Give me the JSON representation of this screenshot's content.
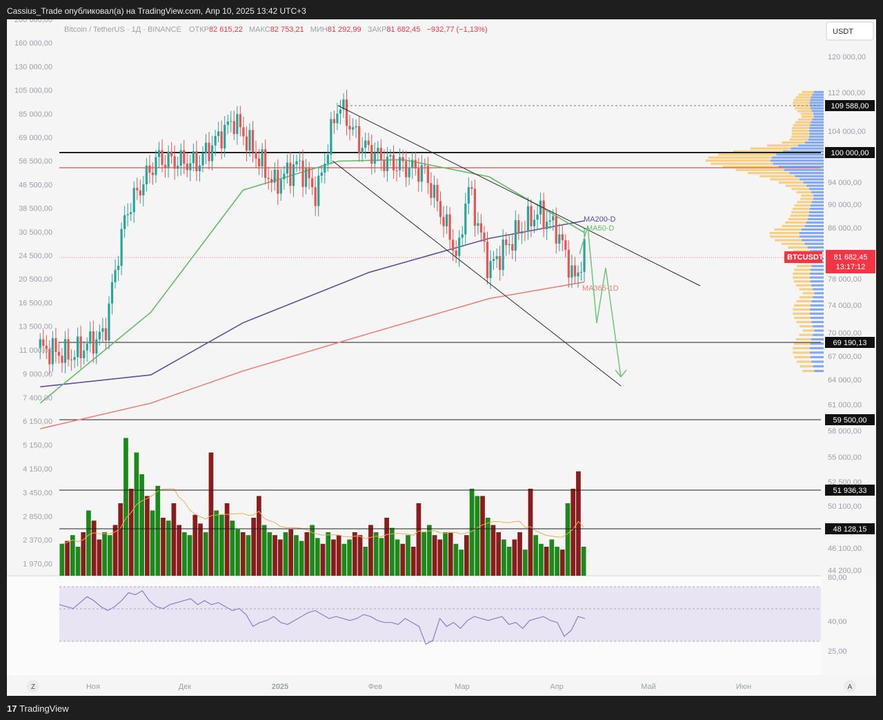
{
  "header": {
    "publish_line": "Cassius_Trade опубликовал(а) на TradingView.com, Апр 10, 2025 13:42 UTC+3"
  },
  "footer": {
    "brand": "TradingView",
    "logo_icon": "tradingview-logo-icon"
  },
  "symbol_info": {
    "name": "Bitcoin / TetherUS · 1Д · BINANCE",
    "open_label": "ОТКР",
    "open": "82 615,22",
    "high_label": "МАКС",
    "high": "82 753,21",
    "low_label": "МИН",
    "low": "81 292,99",
    "close_label": "ЗАКР",
    "close": "81 682,45",
    "change": "−932,77 (−1,13%)",
    "down_color": "#f23645"
  },
  "currency_button": "USDT",
  "corner_buttons": {
    "left": "Z",
    "right": "A"
  },
  "chart_data": {
    "type": "candlestick",
    "symbol": "BTCUSDT",
    "last_price": "81 682,45",
    "countdown": "13:17:12",
    "left_axis": [
      "200 000,00",
      "160 000,00",
      "130 000,00",
      "105 000,00",
      "85 000,00",
      "69 000,00",
      "56 500,00",
      "46 500,00",
      "38 500,00",
      "30 500,00",
      "24 500,00",
      "20 500,00",
      "16 500,00",
      "13 500,00",
      "11 000,00",
      "9 000,00",
      "7 400,00",
      "6 150,00",
      "5 150,00",
      "4 150,00",
      "3 450,00",
      "2 850,00",
      "2 370,00",
      "1 970,00"
    ],
    "right_axis": [
      "120 000,00",
      "112 000,00",
      "104 000,00",
      "94 000,00",
      "90 000,00",
      "86 000,00",
      "78 000,00",
      "74 000,00",
      "70 000,00",
      "67 000,00",
      "64 000,00",
      "61 000,00",
      "58 000,00",
      "55 000,00",
      "52 500,00",
      "50 100,00",
      "46 100,00",
      "44 200,00"
    ],
    "x_axis": [
      "Ноя",
      "Дек",
      "2025",
      "Фев",
      "Мар",
      "Апр",
      "Май",
      "Июн"
    ],
    "levels": [
      {
        "value": 109588.0,
        "label": "109 588,00",
        "style": "dashed"
      },
      {
        "value": 100000.0,
        "label": "100 000,00",
        "style": "solid-thick"
      },
      {
        "value": 96500,
        "label": "",
        "style": "red"
      },
      {
        "value": 69190.13,
        "label": "69 190,13",
        "style": "solid"
      },
      {
        "value": 59500.0,
        "label": "59 500,00",
        "style": "solid"
      },
      {
        "value": 51936.33,
        "label": "51 936,33",
        "style": "solid"
      },
      {
        "value": 48128.15,
        "label": "48 128,15",
        "style": "solid"
      }
    ],
    "ma_labels": {
      "ma200": "MA200-D",
      "ma200_color": "#5b4fa0",
      "ma50": "MA50-D",
      "ma50_color": "#66bb6a",
      "ma365": "MA365-1D",
      "ma365_color": "#ef8079"
    },
    "price_series": [
      [
        "2024-10-15",
        67000
      ],
      [
        "2024-10-25",
        66000
      ],
      [
        "2024-11-05",
        69000
      ],
      [
        "2024-11-12",
        88000
      ],
      [
        "2024-11-22",
        98000
      ],
      [
        "2024-12-05",
        97000
      ],
      [
        "2024-12-17",
        106000
      ],
      [
        "2024-12-30",
        93000
      ],
      [
        "2025-01-07",
        97000
      ],
      [
        "2025-01-13",
        91000
      ],
      [
        "2025-01-20",
        109500
      ],
      [
        "2025-01-27",
        101000
      ],
      [
        "2025-02-04",
        97500
      ],
      [
        "2025-02-17",
        95500
      ],
      [
        "2025-02-28",
        80000
      ],
      [
        "2025-03-03",
        93000
      ],
      [
        "2025-03-10",
        78500
      ],
      [
        "2025-03-20",
        85000
      ],
      [
        "2025-03-26",
        88000
      ],
      [
        "2025-04-01",
        85000
      ],
      [
        "2025-04-07",
        76500
      ],
      [
        "2025-04-10",
        81682
      ]
    ],
    "ma_series": {
      "ma200": [
        [
          "2024-10-15",
          62000
        ],
        [
          "2024-11-20",
          63500
        ],
        [
          "2024-12-20",
          70500
        ],
        [
          "2025-01-30",
          78000
        ],
        [
          "2025-03-10",
          83500
        ],
        [
          "2025-04-10",
          86500
        ]
      ],
      "ma50": [
        [
          "2024-10-15",
          60000
        ],
        [
          "2024-11-20",
          72000
        ],
        [
          "2024-12-20",
          92000
        ],
        [
          "2025-01-20",
          97500
        ],
        [
          "2025-02-10",
          97800
        ],
        [
          "2025-03-10",
          94500
        ],
        [
          "2025-04-10",
          84500
        ]
      ],
      "ma365": [
        [
          "2024-10-15",
          57000
        ],
        [
          "2024-11-20",
          60000
        ],
        [
          "2024-12-20",
          64000
        ],
        [
          "2025-01-30",
          69000
        ],
        [
          "2025-03-10",
          74000
        ],
        [
          "2025-04-10",
          76500
        ]
      ]
    },
    "volume": {
      "unit": "relative",
      "values": [
        0.22,
        0.24,
        0.28,
        0.2,
        0.3,
        0.45,
        0.38,
        0.25,
        0.3,
        0.28,
        0.35,
        0.5,
        0.95,
        0.6,
        0.85,
        0.7,
        0.55,
        0.45,
        0.62,
        0.4,
        0.38,
        0.5,
        0.35,
        0.3,
        0.28,
        0.42,
        0.36,
        0.3,
        0.85,
        0.45,
        0.42,
        0.5,
        0.38,
        0.32,
        0.3,
        0.28,
        0.4,
        0.55,
        0.35,
        0.3,
        0.28,
        0.25,
        0.3,
        0.32,
        0.28,
        0.24,
        0.3,
        0.35,
        0.26,
        0.22,
        0.3,
        0.25,
        0.28,
        0.22,
        0.25,
        0.3,
        0.28,
        0.2,
        0.35,
        0.3,
        0.26,
        0.4,
        0.33,
        0.25,
        0.22,
        0.28,
        0.2,
        0.5,
        0.3,
        0.35,
        0.28,
        0.25,
        0.3,
        0.3,
        0.22,
        0.18,
        0.28,
        0.6,
        0.55,
        0.55,
        0.4,
        0.35,
        0.3,
        0.25,
        0.2,
        0.25,
        0.3,
        0.18,
        0.6,
        0.28,
        0.22,
        0.2,
        0.25,
        0.2,
        0.18,
        0.5,
        0.6,
        0.72,
        0.2
      ],
      "ma_color": "#f5a94d",
      "up_color": "#1b8a1b",
      "down_color": "#8a1c1c"
    },
    "rsi": {
      "axis": [
        "80,00",
        "40,00",
        "25,00"
      ],
      "values": [
        62,
        60,
        58,
        64,
        70,
        66,
        60,
        56,
        60,
        66,
        74,
        72,
        76,
        66,
        60,
        58,
        62,
        64,
        66,
        68,
        62,
        66,
        62,
        64,
        60,
        56,
        58,
        52,
        40,
        44,
        46,
        50,
        44,
        42,
        46,
        50,
        54,
        56,
        52,
        48,
        50,
        48,
        46,
        48,
        52,
        50,
        46,
        44,
        44,
        42,
        48,
        44,
        40,
        22,
        26,
        48,
        40,
        44,
        38,
        46,
        50,
        48,
        46,
        48,
        50,
        42,
        44,
        38,
        46,
        48,
        50,
        46,
        44,
        30,
        36,
        50,
        48
      ],
      "line_color": "#8e7cc3",
      "band_color": "#e9e4f3"
    },
    "volume_profile": {
      "buy_color": "#f7c25c",
      "sell_color": "#5b8def"
    },
    "forecast": {
      "color": "#77c77b"
    },
    "grid": false
  }
}
